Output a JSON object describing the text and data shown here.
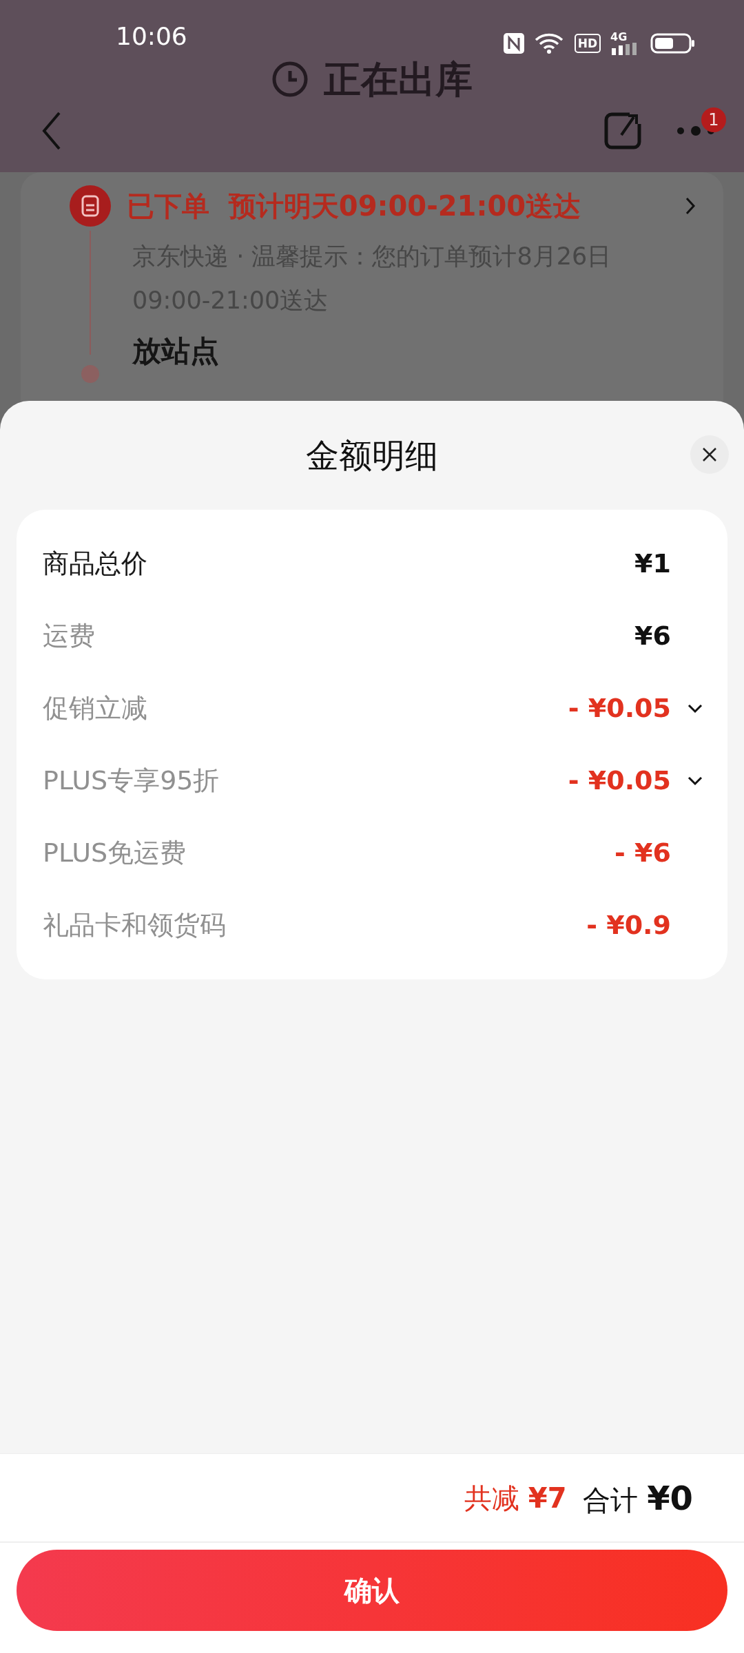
{
  "status_bar": {
    "time": "10:06",
    "hd": "HD",
    "network": "4G"
  },
  "header": {
    "title": "正在出库",
    "more_badge": "1"
  },
  "order": {
    "status": "已下单",
    "eta": "预计明天09:00-21:00送达",
    "note": "京东快递 · 温馨提示：您的订单预计8月26日09:00-21:00送达",
    "next_step": "放站点"
  },
  "sheet": {
    "title": "金额明细",
    "rows": [
      {
        "label": "商品总价",
        "value": "¥1",
        "kind": "main",
        "expandable": false
      },
      {
        "label": "运费",
        "value": "¥6",
        "kind": "charge",
        "expandable": false
      },
      {
        "label": "促销立减",
        "value": "- ¥0.05",
        "kind": "discount",
        "expandable": true
      },
      {
        "label": "PLUS专享95折",
        "value": "- ¥0.05",
        "kind": "discount",
        "expandable": true
      },
      {
        "label": "PLUS免运费",
        "value": "- ¥6",
        "kind": "discount",
        "expandable": false
      },
      {
        "label": "礼品卡和领货码",
        "value": "- ¥0.9",
        "kind": "discount",
        "expandable": false
      }
    ],
    "summary": {
      "saved_label": "共减",
      "saved_value": "¥7",
      "total_label": "合计",
      "total_value": "¥0"
    },
    "confirm": "确认"
  }
}
